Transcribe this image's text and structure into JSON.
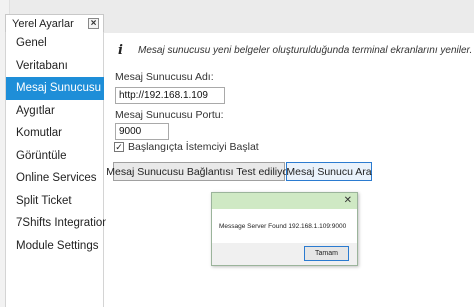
{
  "panel": {
    "title": "Yerel Ayarlar",
    "close_glyph": "×"
  },
  "sidebar": {
    "items": [
      {
        "label": "Genel",
        "active": false
      },
      {
        "label": "Veritabanı",
        "active": false
      },
      {
        "label": "Mesaj Sunucusu",
        "active": true
      },
      {
        "label": "Aygıtlar",
        "active": false
      },
      {
        "label": "Komutlar",
        "active": false
      },
      {
        "label": "Görüntüle",
        "active": false
      },
      {
        "label": "Online Services",
        "active": false
      },
      {
        "label": "Split Ticket",
        "active": false
      },
      {
        "label": "7Shifts Integration",
        "active": false
      },
      {
        "label": "Module Settings",
        "active": false
      }
    ]
  },
  "content": {
    "info_icon": "i",
    "info_text": "Mesaj sunucusu yeni belgeler oluşturulduğunda terminal ekranlarını yeniler.",
    "server_name_label": "Mesaj Sunucusu Adı:",
    "server_name_value": "http://192.168.1.109",
    "server_port_label": "Mesaj Sunucusu Portu:",
    "server_port_value": "9000",
    "startup_checkbox_checked": true,
    "startup_checkbox_label": "Başlangıçta İstemciyi Başlat",
    "test_button_label": "Mesaj Sunucusu Bağlantısı Test ediliyor",
    "search_button_label": "Mesaj Sunucu Ara"
  },
  "dialog": {
    "close_glyph": "✕",
    "message": "Message Server Found 192.168.1.109:9000",
    "ok_label": "Tamam"
  },
  "colors": {
    "accent": "#1e8ed8",
    "dialog_title_bg": "#cfe9c4"
  }
}
